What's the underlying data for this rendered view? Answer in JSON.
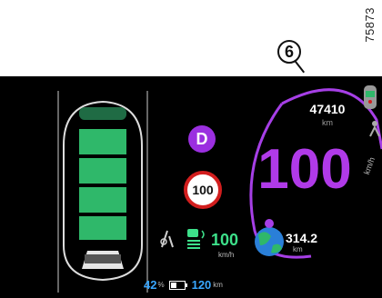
{
  "reference_number": "75873",
  "callout_label": "6",
  "dashboard": {
    "gear": "D",
    "speed_limit": "100",
    "odometer": {
      "value": "47410",
      "unit": "km"
    },
    "speed": {
      "value": "100",
      "unit": "km/h"
    },
    "cruise": {
      "value": "100",
      "unit": "km/h"
    },
    "eco_range": {
      "value": "314.2",
      "unit": "km"
    },
    "battery": {
      "percent_value": "42",
      "percent_sign": "%",
      "range_value": "120",
      "range_unit": "km",
      "level": 0.42
    },
    "icons": [
      "car-top-view-icon",
      "lane-assist-icon",
      "adaptive-cruise-icon",
      "eco-globe-icon",
      "battery-icon",
      "vehicle-status-icon",
      "seatbelt-icon"
    ],
    "colors": {
      "accent_purple": "#b03ae8",
      "battery_green": "#2fb86a",
      "limit_red": "#d21e1e",
      "cruise_green": "#3de08a",
      "blue_text": "#39a7ff"
    }
  }
}
